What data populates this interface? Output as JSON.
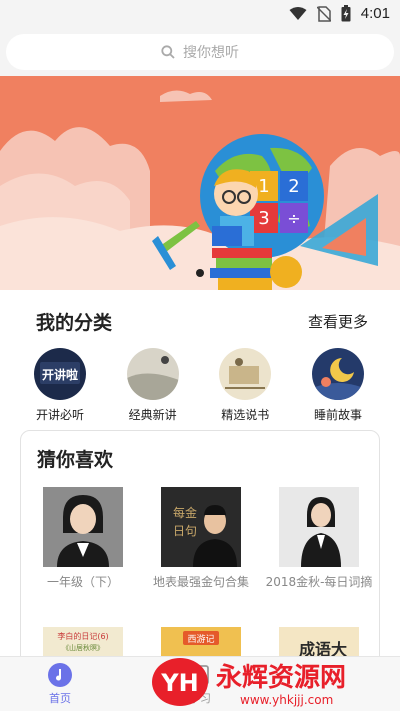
{
  "status_bar": {
    "time": "4:01"
  },
  "search": {
    "placeholder": "搜你想听"
  },
  "categories": {
    "title": "我的分类",
    "more": "查看更多",
    "items": [
      {
        "label": "开讲必听",
        "thumb_text": "开讲啦"
      },
      {
        "label": "经典新讲"
      },
      {
        "label": "精选说书"
      },
      {
        "label": "睡前故事"
      }
    ]
  },
  "recommend": {
    "title": "猜你喜欢",
    "items": [
      {
        "label": "一年级（下）"
      },
      {
        "label": "地表最强金句合集",
        "thumb_text": [
          "每",
          "日",
          "金",
          "句"
        ]
      },
      {
        "label": "2018金秋-每日词摘"
      }
    ],
    "row2": [
      {
        "title": "李白的日记(6)",
        "subtitle": "《山居秋暝》"
      },
      {
        "title": "西游记"
      },
      {
        "title": "成语大"
      }
    ]
  },
  "bottom_nav": [
    {
      "label": "首页"
    },
    {
      "label": "学习"
    }
  ],
  "watermark": {
    "logo": "YH",
    "name": "永辉资源网",
    "url": "www.yhkjjj.com"
  },
  "colors": {
    "accent": "#6b72e8",
    "banner_bg": "#f08060",
    "watermark_red": "#e8202a"
  }
}
